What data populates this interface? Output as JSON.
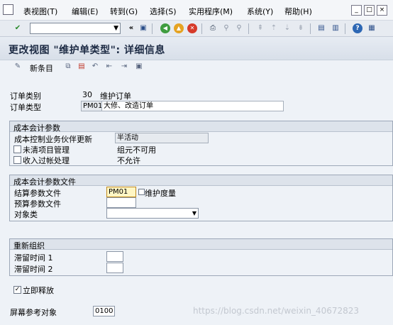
{
  "menubar": {
    "items": [
      "表视图(T)",
      "编辑(E)",
      "转到(G)",
      "选择(S)",
      "实用程序(M)",
      "系统(Y)",
      "帮助(H)"
    ]
  },
  "toolbar": {
    "command_value": "",
    "icons": [
      "enter-icon",
      "save-icon",
      "back-icon",
      "exit-icon",
      "cancel-icon",
      "print-icon",
      "find-icon",
      "find-next-icon",
      "first-page-icon",
      "prev-page-icon",
      "next-page-icon",
      "last-page-icon",
      "new-session-icon",
      "shortcut-icon",
      "help-icon",
      "layout-icon"
    ]
  },
  "page": {
    "title": "更改视图 \"维护单类型\": 详细信息",
    "new_entries": "新条目"
  },
  "header": {
    "order_category_label": "订单类别",
    "order_category_code": "30",
    "order_category_text": "维护订单",
    "order_type_label": "订单类型",
    "order_type_code": "PM01",
    "order_type_text": "大修、改造订单"
  },
  "co_params": {
    "title": "成本会计参数",
    "cost_update_label": "成本控制业务伙伴更新",
    "cost_update_value": "半活动",
    "open_items_label": "未清项目管理",
    "open_items_value": "组元不可用",
    "revenue_label": "收入过帐处理",
    "revenue_value": "不允许"
  },
  "co_profiles": {
    "title": "成本会计参数文件",
    "settlement_label": "结算参数文件",
    "settlement_value": "PM01",
    "settlement_text": "维护度量",
    "budget_label": "预算参数文件",
    "budget_value": "",
    "object_class_label": "对象类",
    "object_class_value": ""
  },
  "reorg": {
    "title": "重新组织",
    "residence1_label": "滞留时间 1",
    "residence1_value": "",
    "residence2_label": "滞留时间 2",
    "residence2_value": ""
  },
  "release": {
    "label": "立即释放",
    "checked": true
  },
  "screen_ref": {
    "label": "屏幕参考对象",
    "value": "0100"
  },
  "watermark": "https://blog.csdn.net/weixin_40672823"
}
